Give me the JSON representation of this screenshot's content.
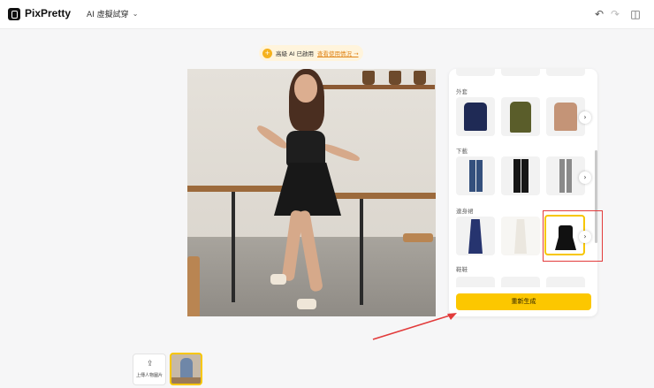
{
  "app": {
    "brand": "PixPretty",
    "mode": "AI 虛擬試穿"
  },
  "banner": {
    "text": "高級 AI 已啟用",
    "link": "查看使用情況 →"
  },
  "panel": {
    "sections": [
      {
        "label": "外套",
        "items": [
          "navy-jacket",
          "olive-trench-coat",
          "tan-blazer"
        ]
      },
      {
        "label": "下載",
        "items": [
          "blue-jeans",
          "black-trousers",
          "gray-leggings"
        ]
      },
      {
        "label": "連身裙",
        "items": [
          "navy-slip-dress",
          "white-maxi-dress",
          "black-mini-dress"
        ],
        "selected": 2
      },
      {
        "label": "鞋鞋"
      }
    ],
    "regenerate": "重新生成"
  },
  "upload": {
    "label": "上傳人物圖片"
  },
  "colors": {
    "accent": "#fcc700",
    "selected_border": "#f7c600",
    "annotation": "#e23b3b"
  }
}
